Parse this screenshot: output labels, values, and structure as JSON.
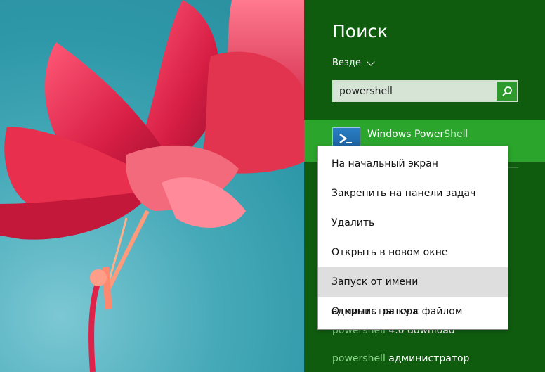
{
  "search_pane": {
    "title": "Поиск",
    "scope": "Везде",
    "query": "powershell"
  },
  "top_result": {
    "label_prefix": "Windows Power",
    "label_highlight": "Shell",
    "icon": "powershell-app-icon"
  },
  "suggestions": [
    {
      "dim": "powershell",
      "rest": " 4.0 download"
    },
    {
      "dim": "powershell",
      "rest": " администратор"
    }
  ],
  "context_menu": {
    "items": [
      "На начальный экран",
      "Закрепить на панели задач",
      "Удалить",
      "Открыть в новом окне",
      "Запуск от имени администратора",
      "Открыть папку с файлом"
    ],
    "hovered_index": 4
  },
  "colors": {
    "pane_bg": "#0f5c0f",
    "accent": "#2ca52c",
    "menu_hover": "#dedede",
    "wallpaper": "#2e98a8",
    "flower": "#d9264a"
  }
}
